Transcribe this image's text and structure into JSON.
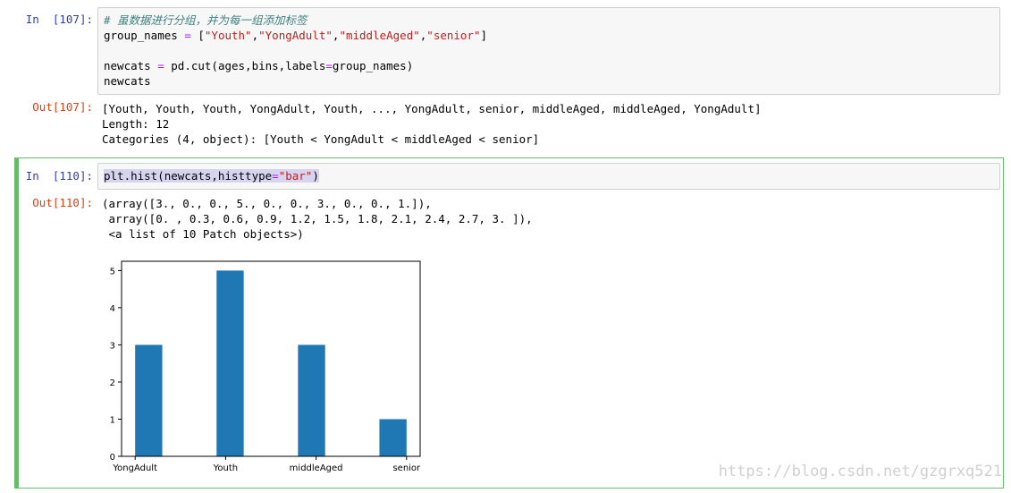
{
  "cells": [
    {
      "in_prompt": "In  [107]:",
      "code": {
        "comment": "# 虽数据进行分组，并为每一组添加标签",
        "line2_a": "group_names ",
        "line2_eq": "=",
        "line2_b": " [",
        "line2_s1": "\"Youth\"",
        "line2_c1": ",",
        "line2_s2": "\"YongAdult\"",
        "line2_c2": ",",
        "line2_s3": "\"middleAged\"",
        "line2_c3": ",",
        "line2_s4": "\"senior\"",
        "line2_end": "]",
        "line4_a": "newcats ",
        "line4_eq": "=",
        "line4_b": " pd.cut(ages,bins,labels",
        "line4_eq2": "=",
        "line4_c": "group_names)",
        "line5": "newcats"
      },
      "out_prompt": "Out[107]:",
      "output": [
        "[Youth, Youth, Youth, YongAdult, Youth, ..., YongAdult, senior, middleAged, middleAged, YongAdult]",
        "Length: 12",
        "Categories (4, object): [Youth < YongAdult < middleAged < senior]"
      ]
    },
    {
      "in_prompt": "In  [110]:",
      "code": {
        "a": "plt.hist(newcats,histtype",
        "eq": "=",
        "s": "\"bar\"",
        "end": ")"
      },
      "out_prompt": "Out[110]:",
      "output": [
        "(array([3., 0., 0., 5., 0., 0., 3., 0., 0., 1.]),",
        " array([0. , 0.3, 0.6, 0.9, 1.2, 1.5, 1.8, 2.1, 2.4, 2.7, 3. ]),",
        " <a list of 10 Patch objects>)"
      ]
    }
  ],
  "chart_data": {
    "type": "bar",
    "categories": [
      "YongAdult",
      "Youth",
      "middleAged",
      "senior"
    ],
    "values": [
      3,
      5,
      3,
      1
    ],
    "ylim": [
      0,
      5.25
    ],
    "yticks": [
      "0",
      "1",
      "2",
      "3",
      "4",
      "5"
    ],
    "grid": false,
    "color": "#1f77b4"
  },
  "watermark": "https://blog.csdn.net/gzgrxq521"
}
